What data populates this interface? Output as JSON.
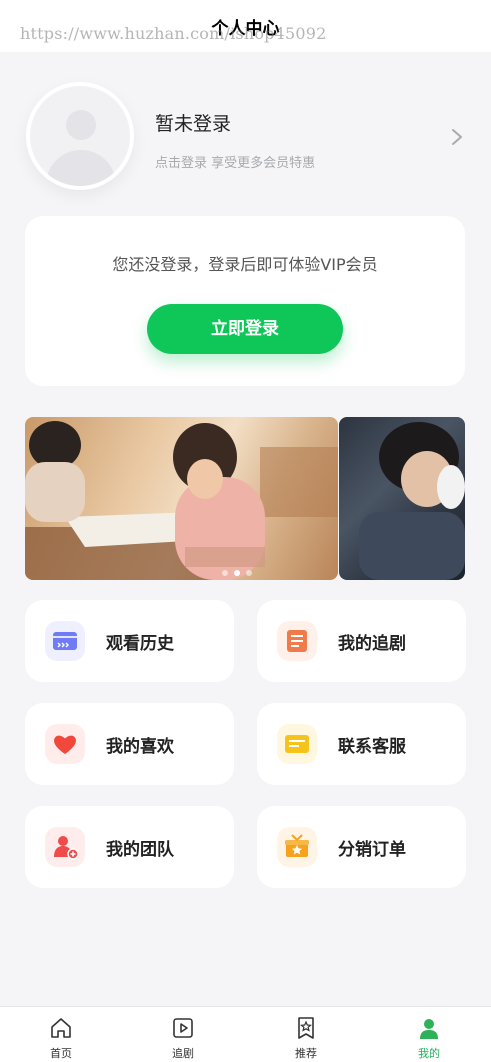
{
  "header": {
    "title": "个人中心",
    "watermark": "https://www.huzhan.com/ishop45092"
  },
  "profile": {
    "name": "暂未登录",
    "subtitle": "点击登录 享受更多会员特惠",
    "avatar_icon": "user-placeholder-icon",
    "chevron_icon": "chevron-right-icon"
  },
  "login_card": {
    "tip": "您还没登录，登录后即可体验VIP会员",
    "button_label": "立即登录",
    "button_color": "#0fc659"
  },
  "banner": {
    "slide_count": 3,
    "active_index": 1
  },
  "menu": [
    {
      "label": "观看历史",
      "icon": "history-icon",
      "color": "#6f7cf5"
    },
    {
      "label": "我的追剧",
      "icon": "follow-list-icon",
      "color": "#f07a4a"
    },
    {
      "label": "我的喜欢",
      "icon": "heart-icon",
      "color": "#f0483a"
    },
    {
      "label": "联系客服",
      "icon": "message-icon",
      "color": "#f6c21c"
    },
    {
      "label": "我的团队",
      "icon": "team-icon",
      "color": "#f04a4a"
    },
    {
      "label": "分销订单",
      "icon": "gift-box-icon",
      "color": "#f6a21c"
    }
  ],
  "tabbar": {
    "items": [
      {
        "label": "首页",
        "icon": "home-icon"
      },
      {
        "label": "追剧",
        "icon": "play-icon"
      },
      {
        "label": "推荐",
        "icon": "star-bookmark-icon"
      },
      {
        "label": "我的",
        "icon": "profile-icon"
      }
    ],
    "active": "我的",
    "active_color": "#1fb25a"
  }
}
